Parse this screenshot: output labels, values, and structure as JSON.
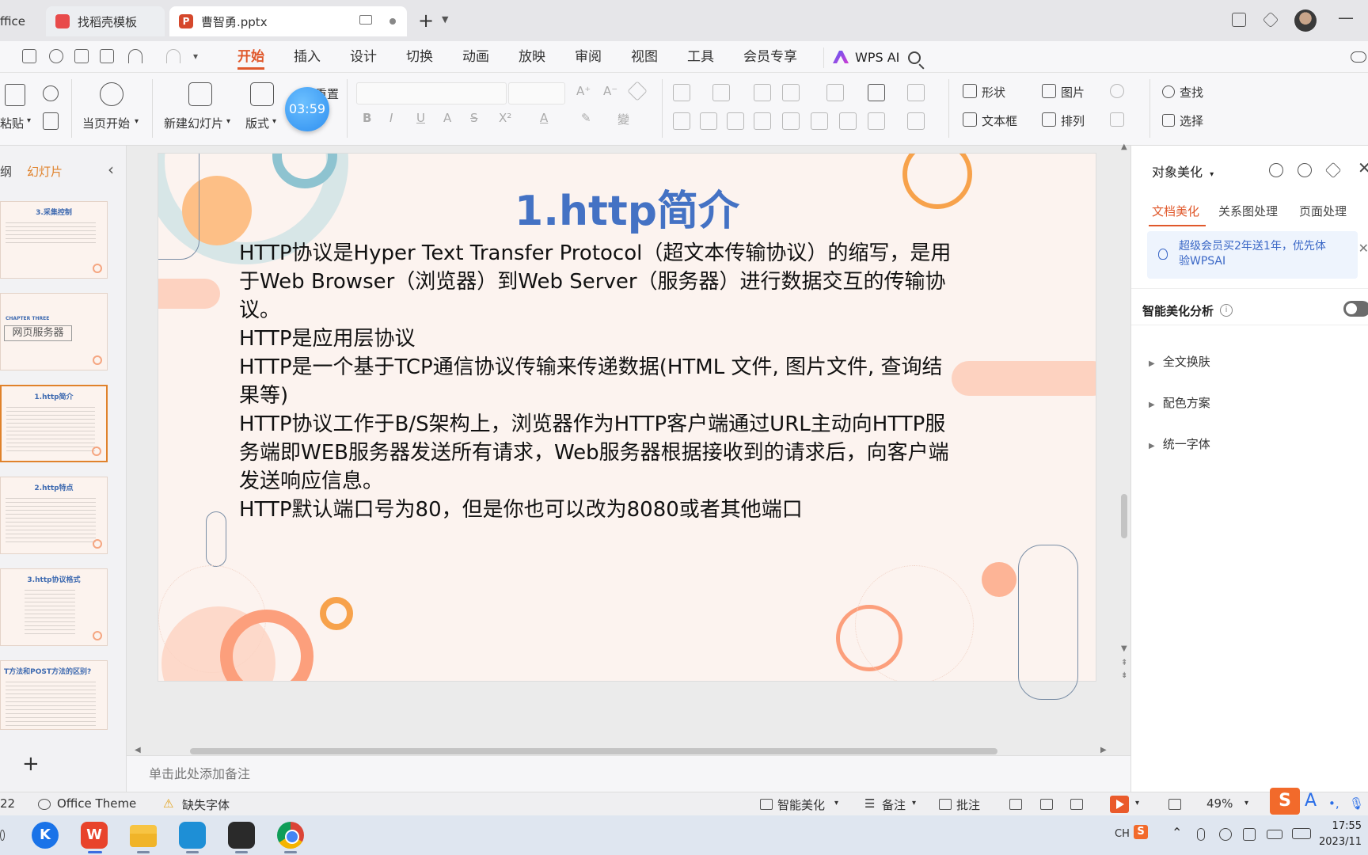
{
  "tabs": {
    "office_label": "ffice",
    "find_label": "找稻壳模板",
    "pptx_label": "曹智勇.pptx",
    "pptx_icon": "P"
  },
  "menu": {
    "items": [
      "开始",
      "插入",
      "设计",
      "切换",
      "动画",
      "放映",
      "审阅",
      "视图",
      "工具",
      "会员专享"
    ],
    "active_index": 0,
    "ai_label": "WPS AI"
  },
  "ribbon": {
    "paste": "粘贴",
    "from_current": "当页开始",
    "new_slide": "新建幻灯片",
    "layout": "版式",
    "reset_partial": "重置",
    "timer": "03:59",
    "shape": "形状",
    "picture": "图片",
    "textbox": "文本框",
    "arrange": "排列",
    "find": "查找",
    "select": "选择"
  },
  "left_panel": {
    "tab_outline": "纲",
    "tab_slides": "幻灯片",
    "thumbnails": [
      {
        "title": "3.采集控制"
      },
      {
        "chapter": "CHAPTER THREE",
        "box": "网页服务器"
      },
      {
        "title": "1.http简介"
      },
      {
        "title": "2.http特点"
      },
      {
        "title": "3.http协议格式"
      },
      {
        "title": "T方法和POST方法的区别?"
      }
    ],
    "selected_index": 2
  },
  "slide": {
    "title": "1.http简介",
    "paragraphs": [
      "HTTP协议是Hyper Text Transfer Protocol（超文本传输协议）的缩写，是用于Web Browser（浏览器）到Web Server（服务器）进行数据交互的传输协议。",
      "HTTP是应用层协议",
      "HTTP是一个基于TCP通信协议传输来传递数据(HTML 文件, 图片文件, 查询结果等)",
      "HTTP协议工作于B/S架构上，浏览器作为HTTP客户端通过URL主动向HTTP服务端即WEB服务器发送所有请求，Web服务器根据接收到的请求后，向客户端发送响应信息。",
      "HTTP默认端口号为80，但是你也可以改为8080或者其他端口"
    ]
  },
  "notes_placeholder": "单击此处添加备注",
  "right_panel": {
    "title": "对象美化",
    "tabs": [
      "文档美化",
      "关系图处理",
      "页面处理"
    ],
    "active_tab": 0,
    "promo": "超级会员买2年送1年，优先体验WPSAI",
    "smart_analysis": "智能美化分析",
    "items": [
      "全文换肤",
      "配色方案",
      "统一字体"
    ]
  },
  "status_bar": {
    "page": "22",
    "theme": "Office Theme",
    "missing_font": "缺失字体",
    "beautify": "智能美化",
    "notes": "备注",
    "comments": "批注",
    "zoom": "49%"
  },
  "taskbar": {
    "lang": "CH",
    "time": "17:55",
    "date": "2023/11"
  },
  "colors": {
    "accent": "#e0582b",
    "title_blue": "#4472c4",
    "slide_bg": "#fcf3ef",
    "deco_orange": "#f7a24b",
    "deco_peach": "#fcb28e",
    "deco_teal": "#a9cfd8"
  }
}
